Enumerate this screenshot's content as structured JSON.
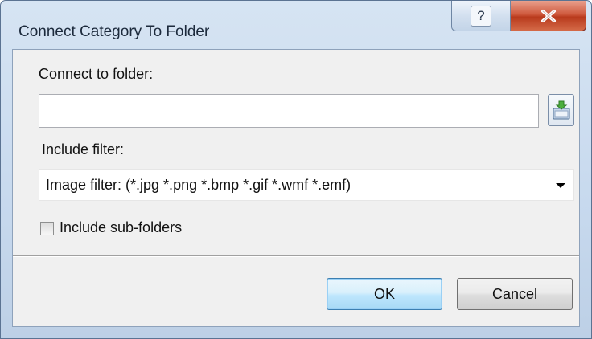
{
  "window": {
    "title": "Connect Category To Folder",
    "help_label": "?",
    "close_icon": "close-icon"
  },
  "folder": {
    "label": "Connect to folder:",
    "value": "",
    "browse_icon": "folder-browse-icon"
  },
  "filter": {
    "label": "Include filter:",
    "selected": "Image filter: (*.jpg *.png *.bmp *.gif *.wmf *.emf)"
  },
  "subfolders": {
    "label": "Include sub-folders",
    "checked": false
  },
  "buttons": {
    "ok": "OK",
    "cancel": "Cancel"
  },
  "colors": {
    "close_red": "#c5472a",
    "ok_blue": "#bee6fd",
    "frame": "#c7d9ee"
  }
}
